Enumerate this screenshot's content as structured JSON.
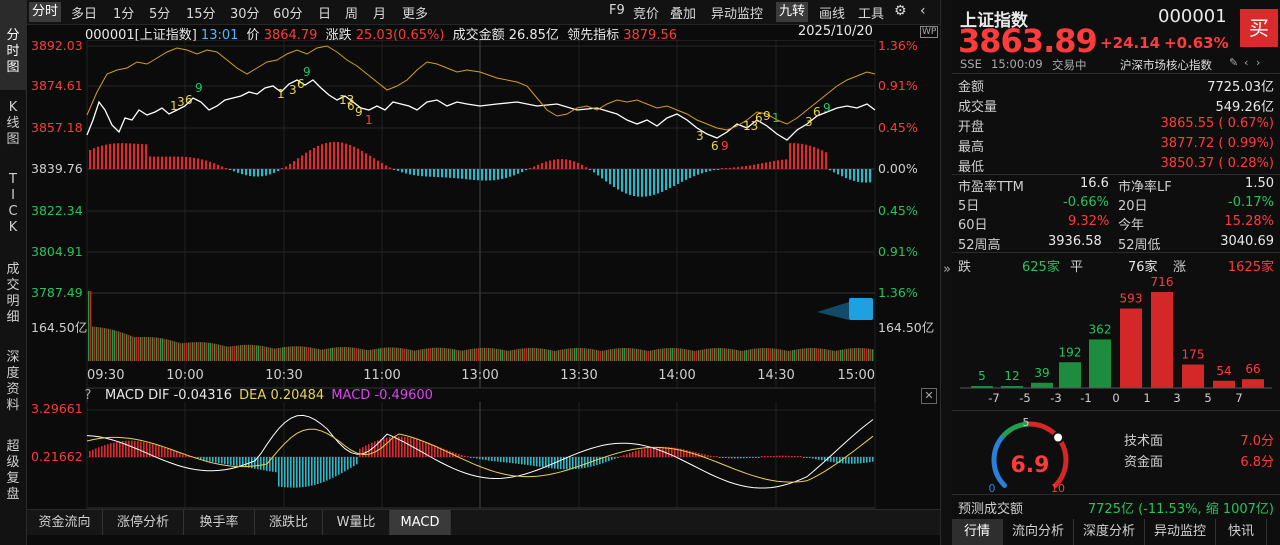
{
  "side_tabs": [
    {
      "label": "分时图"
    },
    {
      "label": "K线图"
    },
    {
      "label": "TICK"
    },
    {
      "label": "成交明细"
    },
    {
      "label": "深度资料"
    },
    {
      "label": "超级复盘"
    }
  ],
  "toolbar": {
    "periods": [
      "分时",
      "多日",
      "1分",
      "5分",
      "15分",
      "30分",
      "60分",
      "日",
      "周",
      "月",
      "更多"
    ],
    "right_items": [
      "F9",
      "竞价",
      "叠加",
      "异动监控",
      "九转",
      "画线",
      "工具"
    ]
  },
  "info": {
    "code_name": "000001[上证指数]",
    "time": "13:01",
    "price_label": "价",
    "price": "3864.79",
    "change_label": "涨跌",
    "change": "25.03(0.65%)",
    "amount_label": "成交金额",
    "amount": "26.85亿",
    "lead_label": "领先指标",
    "lead": "3879.56",
    "date": "2025/10/20"
  },
  "y_left": [
    "3892.03",
    "3874.61",
    "3857.18",
    "3839.76",
    "3822.34",
    "3804.91",
    "3787.49"
  ],
  "y_right": [
    "1.36%",
    "0.91%",
    "0.45%",
    "0.00%",
    "0.45%",
    "0.91%",
    "1.36%"
  ],
  "volume_label": "164.50亿",
  "x_labels": [
    "09:30",
    "10:00",
    "10:30",
    "11:00",
    "13:00",
    "13:30",
    "14:00",
    "14:30",
    "15:00"
  ],
  "nine_turn_marks": [
    "1",
    "3",
    "6",
    "9",
    "1",
    "3",
    "6",
    "9",
    "13",
    "6",
    "9",
    "1",
    "3",
    "6",
    "9",
    "13",
    "6",
    "9",
    "1",
    "3",
    "6",
    "9"
  ],
  "macd": {
    "label": "MACD",
    "dif_label": "DIF",
    "dif": "-0.04316",
    "dea_label": "DEA",
    "dea": "0.20484",
    "macd_label": "MACD",
    "macd_val": "-0.49600",
    "y_top": "3.29661",
    "y_mid": "0.21662",
    "help": "?"
  },
  "bottom_tabs": [
    "资金流向",
    "涨停分析",
    "换手率",
    "涨跌比",
    "W量比",
    "MACD"
  ],
  "quote": {
    "name": "上证指数",
    "code": "000001",
    "price": "3863.89",
    "change": "+24.14",
    "pct": "+0.63%",
    "buy_label": "买",
    "exchange": "SSE",
    "time": "15:00:09",
    "status": "交易中",
    "index_group": "沪深市场核心指数"
  },
  "stats": [
    {
      "label": "金额",
      "value": "7725.03亿"
    },
    {
      "label": "成交量",
      "value": "549.26亿"
    },
    {
      "label": "开盘",
      "value": "3865.55 ( 0.67%)"
    },
    {
      "label": "最高",
      "value": "3877.72 ( 0.99%)"
    },
    {
      "label": "最低",
      "value": "3850.37 ( 0.28%)"
    }
  ],
  "stats2": [
    {
      "l1": "市盈率TTM",
      "v1": "16.6",
      "l2": "市净率LF",
      "v2": "1.50"
    },
    {
      "l1": "5日",
      "v1": "-0.66%",
      "l2": "20日",
      "v2": "-0.17%"
    },
    {
      "l1": "60日",
      "v1": "9.32%",
      "l2": "今年",
      "v2": "15.28%"
    },
    {
      "l1": "52周高",
      "v1": "3936.58",
      "l2": "52周低",
      "v2": "3040.69"
    }
  ],
  "breadth": {
    "down_label": "跌",
    "down": "625家",
    "flat_label": "平",
    "flat": "76家",
    "up_label": "涨",
    "up": "1625家"
  },
  "dist": {
    "values": [
      5,
      12,
      39,
      192,
      362,
      593,
      716,
      175,
      54,
      66
    ],
    "labels": [
      "5",
      "12",
      "39",
      "192",
      "362",
      "593",
      "716",
      "175",
      "54",
      "66"
    ],
    "axis": [
      "-7",
      "-5",
      "-3",
      "-1",
      "0",
      "1",
      "3",
      "5",
      "7"
    ]
  },
  "gauge": {
    "value": "6.9",
    "value_num": 6.9,
    "ticks": [
      "0",
      "5",
      "10"
    ],
    "tech_label": "技术面",
    "tech": "7.0分",
    "fund_label": "资金面",
    "fund": "6.8分"
  },
  "forecast": {
    "label": "预测成交额",
    "value": "7725亿 (-11.53%, 缩 1007亿)"
  },
  "right_tabs": [
    "行情",
    "流向分析",
    "深度分析",
    "异动监控",
    "快讯"
  ],
  "colors": {
    "up": "#ff3b3b",
    "down": "#22c55e",
    "price_line": "#ffffff",
    "avg_line": "#d4a017",
    "dif": "#ffffff",
    "dea": "#e8d44d",
    "macd": "#d946ef"
  }
}
